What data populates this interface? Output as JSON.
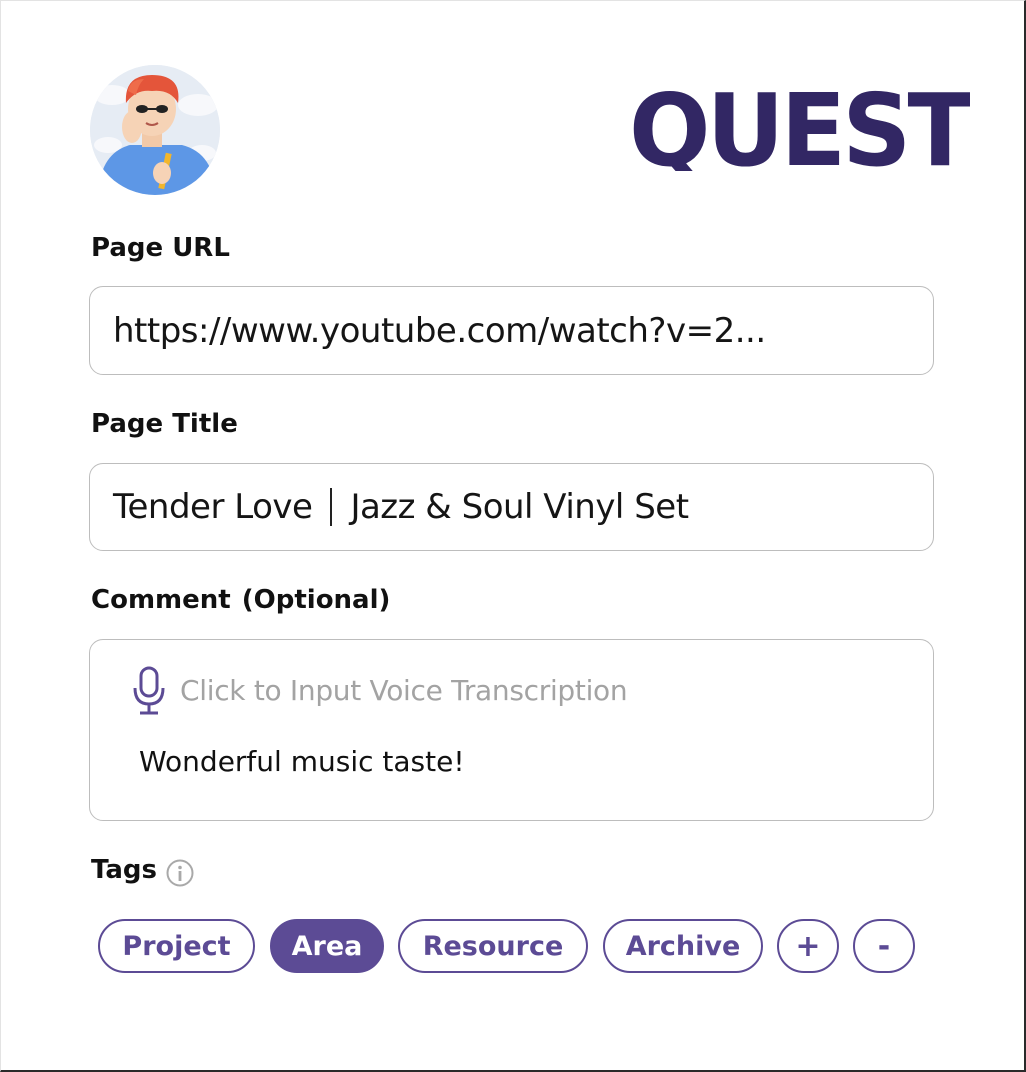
{
  "brand": {
    "logo_text": "QUEST",
    "logo_color": "#322764"
  },
  "form": {
    "url": {
      "label": "Page URL",
      "value": "https://www.youtube.com/watch?v=2..."
    },
    "title": {
      "label": "Page Title",
      "value_part1": "Tender Love",
      "value_part2": "Jazz & Soul Vinyl Set"
    },
    "comment": {
      "label": "Comment  (Optional)",
      "voice_placeholder": "Click to Input Voice Transcription",
      "value": "Wonderful music taste!"
    },
    "tags": {
      "label": "Tags",
      "items": [
        {
          "label": "Project",
          "selected": false
        },
        {
          "label": "Area",
          "selected": true
        },
        {
          "label": "Resource",
          "selected": false
        },
        {
          "label": "Archive",
          "selected": false
        }
      ],
      "add_label": "+",
      "remove_label": "-"
    }
  },
  "colors": {
    "accent": "#5c4b95",
    "logo": "#322764",
    "border": "#bdbdbd",
    "placeholder": "#a3a3a3"
  },
  "icons": {
    "avatar": "avatar-cartoon-person",
    "mic": "microphone-icon",
    "info": "info-icon"
  }
}
